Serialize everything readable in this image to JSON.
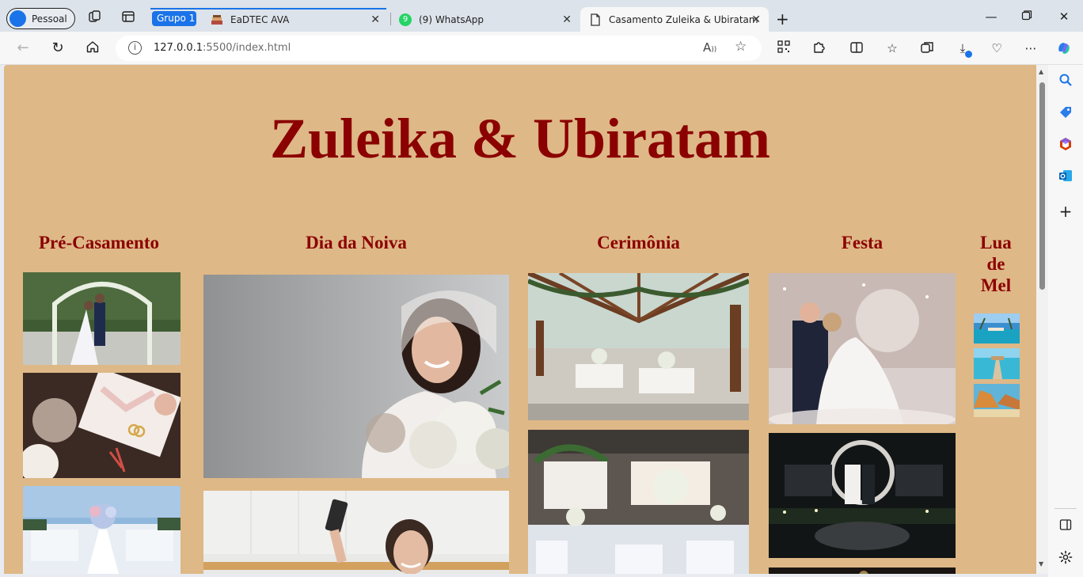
{
  "browser": {
    "profile_label": "Pessoal",
    "group_label": "Grupo 1",
    "tabs": [
      {
        "title": "EaDTEC AVA"
      },
      {
        "title": "(9) WhatsApp",
        "badge": "9"
      },
      {
        "title": "Casamento Zuleika & Ubiratam"
      }
    ],
    "url_host": "127.0.0.1",
    "url_rest": ":5500/index.html"
  },
  "page": {
    "title": "Zuleika & Ubiratam",
    "sections": {
      "pre": "Pré-Casamento",
      "noiva": "Dia da Noiva",
      "cerimonia": "Cerimônia",
      "festa": "Festa",
      "lua_de_mel": "Lua de Mel"
    }
  },
  "colors": {
    "page_background": "#deb887",
    "title_color": "#8b0000",
    "accent": "#1a73e8"
  }
}
